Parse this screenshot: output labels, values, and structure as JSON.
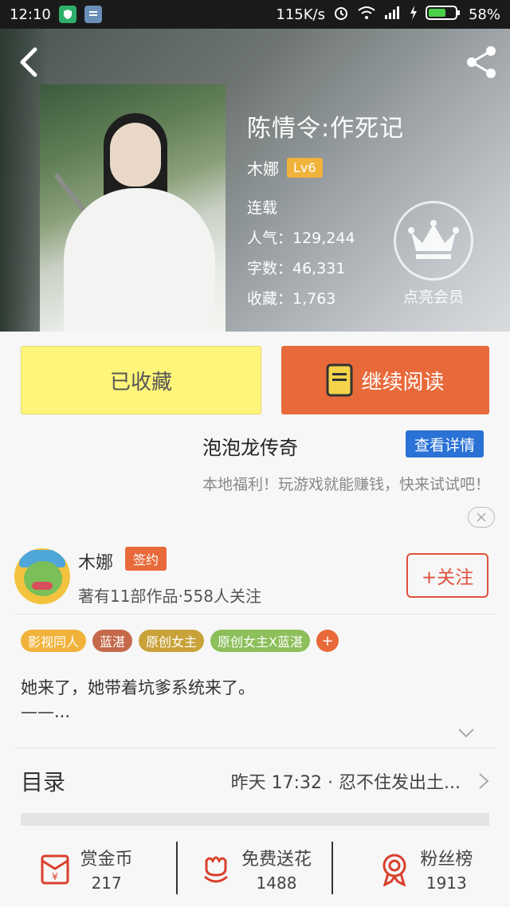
{
  "status_bar": {
    "time": "12:10",
    "net_speed": "115K/s",
    "battery": "58%"
  },
  "book": {
    "title": "陈情令:作死记",
    "author": "木娜",
    "level": "Lv6",
    "status": "连载",
    "popularity": "人气：129,244",
    "word_count": "字数：46,331",
    "favorites": "收藏：1,763"
  },
  "vip": {
    "label": "点亮会员"
  },
  "actions": {
    "favorited_label": "已收藏",
    "continue_label": "继续阅读"
  },
  "ad": {
    "title": "泡泡龙传奇",
    "detail_button": "查看详情",
    "description": "本地福利！玩游戏就能赚钱，快来试试吧！"
  },
  "author_card": {
    "name": "木娜",
    "badge": "签约",
    "meta": "著有11部作品·558人关注",
    "follow_label": "+关注"
  },
  "tags": [
    {
      "label": "影视同人",
      "color": "#f0b23a"
    },
    {
      "label": "蓝湛",
      "color": "#c46a4a"
    },
    {
      "label": "原创女主",
      "color": "#c9a23a"
    },
    {
      "label": "原创女主X蓝湛",
      "color": "#8dbf5a"
    }
  ],
  "tag_add": "+",
  "synopsis": {
    "line1": "她来了，她带着坑爹系统来了。",
    "line2": "——..."
  },
  "toc": {
    "label": "目录",
    "latest": "昨天 17:32 · 忍不住发出土..."
  },
  "bottom": {
    "reward": {
      "label": "赏金币",
      "value": "217",
      "icon": "red-envelope-icon"
    },
    "flower": {
      "label": "免费送花",
      "value": "1488",
      "icon": "flower-icon"
    },
    "fans": {
      "label": "粉丝榜",
      "value": "1913",
      "icon": "medal-icon"
    }
  },
  "colors": {
    "accent_orange": "#e8693a",
    "fav_yellow": "#fff57a",
    "ad_blue": "#2a72d6",
    "follow_red": "#e0513c"
  }
}
